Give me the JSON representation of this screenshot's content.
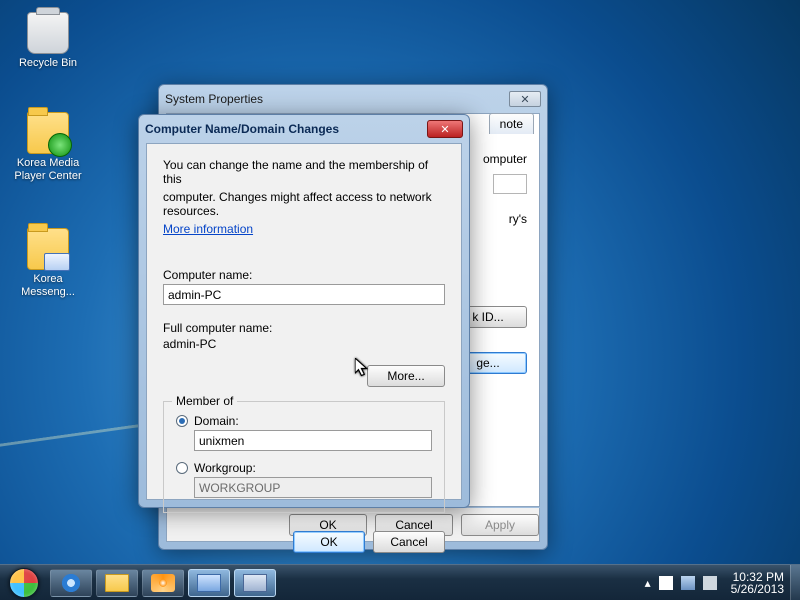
{
  "desktop": {
    "icons": [
      {
        "name": "recycle-bin",
        "label": "Recycle Bin"
      },
      {
        "name": "kmpc",
        "label": "Korea Media Player Center"
      },
      {
        "name": "kmsg",
        "label": "Korea Messeng..."
      }
    ]
  },
  "sysprops": {
    "title": "System Properties",
    "tab_partial_right": "note",
    "partial_line1": "omputer",
    "partial_line2": "ry's",
    "network_id_btn": "k ID...",
    "change_btn_frag": "ge...",
    "ok": "OK",
    "cancel": "Cancel",
    "apply": "Apply"
  },
  "cndc": {
    "title": "Computer Name/Domain Changes",
    "note1": "You can change the name and the membership of this",
    "note2": "computer. Changes might affect access to network resources.",
    "more_info": "More information",
    "computer_name_lbl": "Computer name:",
    "computer_name": "admin-PC",
    "full_name_lbl": "Full computer name:",
    "full_name": "admin-PC",
    "more_btn": "More...",
    "member_of": "Member of",
    "domain_lbl": "Domain:",
    "domain_value": "unixmen",
    "workgroup_lbl": "Workgroup:",
    "workgroup_value": "WORKGROUP",
    "ok": "OK",
    "cancel": "Cancel"
  },
  "taskbar": {
    "clock": {
      "time": "10:32 PM",
      "date": "5/26/2013"
    },
    "show_hidden": "▴"
  }
}
